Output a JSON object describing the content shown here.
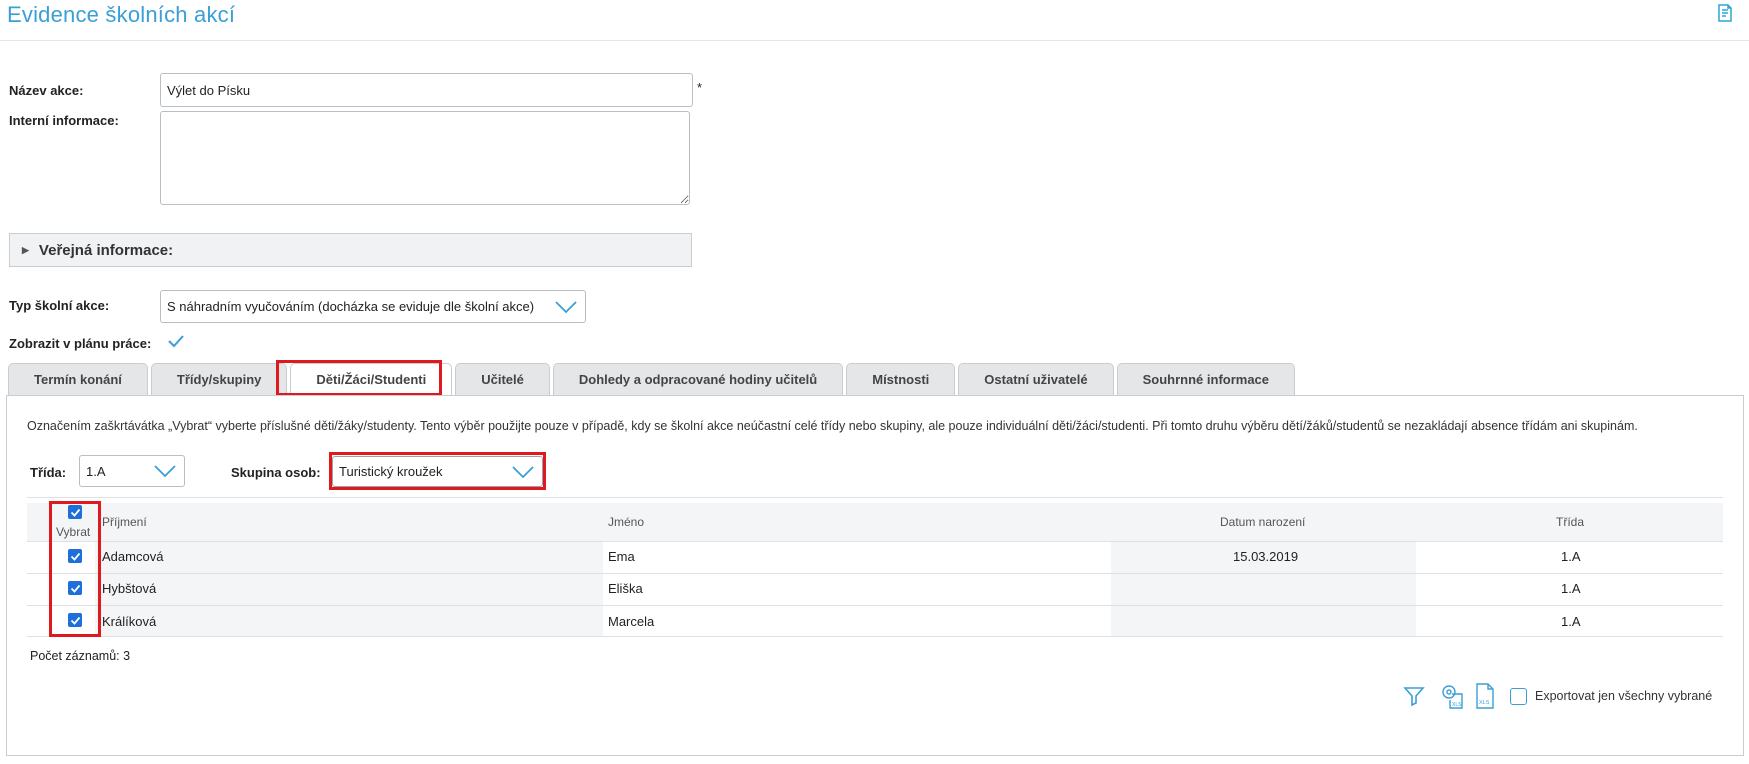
{
  "header": {
    "title": "Evidence školních akcí",
    "help_icon": "help-notes-icon"
  },
  "form": {
    "name_label": "Název akce:",
    "name_value": "Výlet do Písku",
    "required_mark": "*",
    "internal_label": "Interní informace:",
    "internal_value": "",
    "public_info_label": "Veřejná informace:",
    "type_label": "Typ školní akce:",
    "type_value": "S náhradním vyučováním (docházka se eviduje dle školní akce)",
    "show_in_plan_label": "Zobrazit v plánu práce:",
    "show_in_plan_checked": true
  },
  "tabs": [
    {
      "label": "Termín konání",
      "active": false
    },
    {
      "label": "Třídy/skupiny",
      "active": false
    },
    {
      "label": "Děti/Žáci/Studenti",
      "active": true
    },
    {
      "label": "Učitelé",
      "active": false
    },
    {
      "label": "Dohledy a odpracované hodiny učitelů",
      "active": false
    },
    {
      "label": "Místnosti",
      "active": false
    },
    {
      "label": "Ostatní uživatelé",
      "active": false
    },
    {
      "label": "Souhrnné informace",
      "active": false
    }
  ],
  "panel": {
    "note": "Označením zaškrtávátka „Vybrat“ vyberte příslušné děti/žáky/studenty. Tento výběr použijte pouze v případě, kdy se školní akce neúčastní celé třídy nebo skupiny, ale pouze individuální děti/žáci/studenti. Při tomto druhu výběru dětí/žáků/studentů se nezakládají absence třídám ani skupinám.",
    "class_label": "Třída:",
    "class_value": "1.A",
    "group_label": "Skupina osob:",
    "group_value": "Turistický kroužek",
    "table": {
      "headers": {
        "select": "Vybrat",
        "surname": "Příjmení",
        "name": "Jméno",
        "birth": "Datum narození",
        "class": "Třída"
      },
      "rows": [
        {
          "selected": true,
          "surname": "Adamcová",
          "name": "Ema",
          "birth": "15.03.2019",
          "class": "1.A"
        },
        {
          "selected": true,
          "surname": "Hybštová",
          "name": "Eliška",
          "birth": "",
          "class": "1.A"
        },
        {
          "selected": true,
          "surname": "Králíková",
          "name": "Marcela",
          "birth": "",
          "class": "1.A"
        }
      ]
    },
    "record_count": "Počet záznamů: 3",
    "export_only_selected_label": "Exportovat jen všechny vybrané",
    "export_only_selected_checked": false,
    "tool_icons": [
      "filter-icon",
      "export-settings-xls-icon",
      "export-xls-icon"
    ]
  },
  "colors": {
    "accent": "#3a9fd6",
    "highlight": "#e0191f",
    "checkbox": "#1e6fd9"
  }
}
